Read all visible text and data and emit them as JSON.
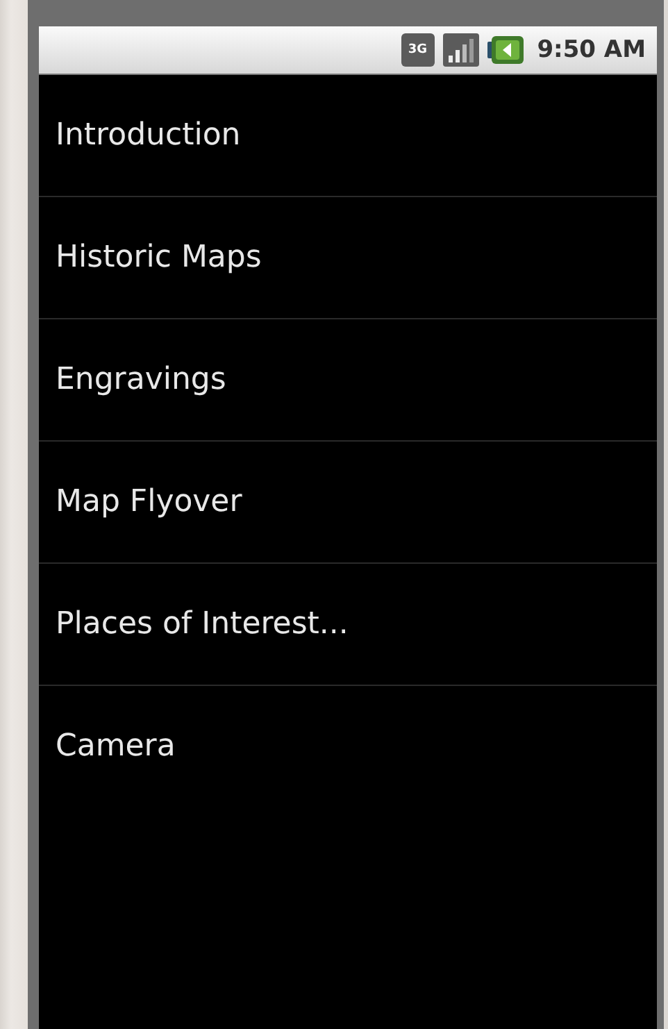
{
  "status_bar": {
    "network": "3G",
    "time": "9:50 AM"
  },
  "menu_items": [
    {
      "label": "Introduction"
    },
    {
      "label": "Historic Maps"
    },
    {
      "label": "Engravings"
    },
    {
      "label": "Map Flyover"
    },
    {
      "label": "Places of Interest..."
    },
    {
      "label": "Camera"
    }
  ]
}
